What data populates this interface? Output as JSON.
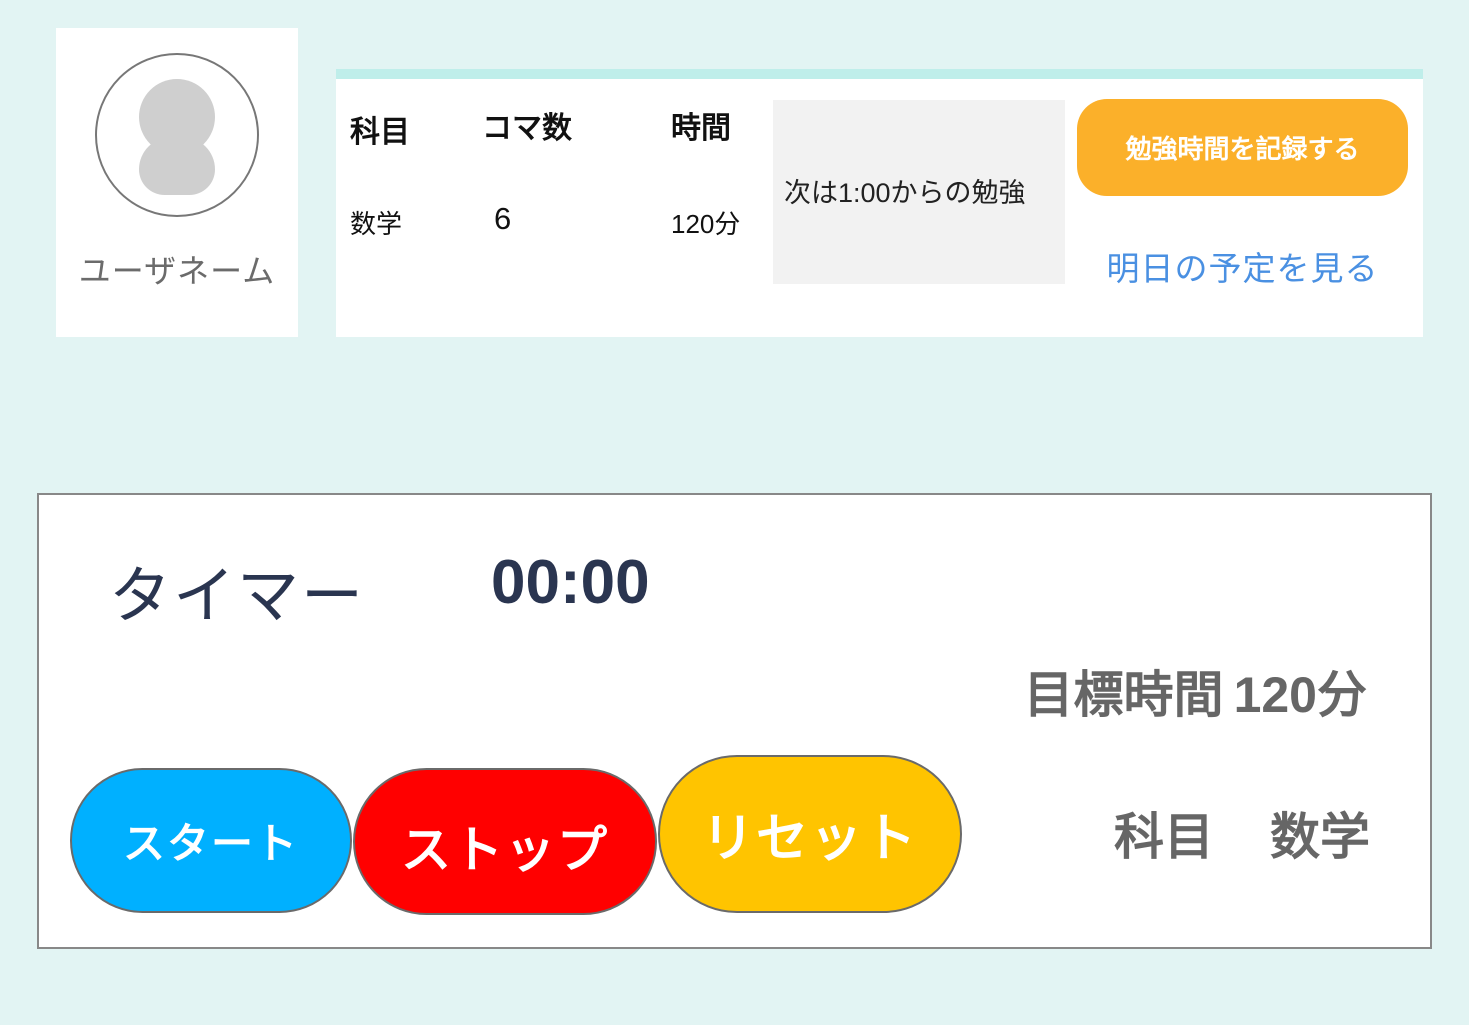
{
  "profile": {
    "username": "ユーザネーム",
    "avatar_icon": "user-silhouette-icon"
  },
  "schedule": {
    "headers": {
      "subject": "科目",
      "koma": "コマ数",
      "time": "時間"
    },
    "row": {
      "subject": "数学",
      "koma": "6",
      "time": "120分"
    },
    "next_study": "次は1:00からの勉強",
    "record_button": "勉強時間を記録する",
    "tomorrow_link": "明日の予定を見る"
  },
  "timer": {
    "label": "タイマー",
    "value": "00:00",
    "goal_label": "目標時間",
    "goal_value": "120分",
    "subject_label": "科目",
    "subject_value": "数学",
    "buttons": {
      "start": "スタート",
      "stop": "ストップ",
      "reset": "リセット"
    }
  },
  "colors": {
    "background": "#e2f4f3",
    "accent_bar": "#bfeeea",
    "record_button": "#fbb02a",
    "link": "#4a90e2",
    "start": "#00b0ff",
    "stop": "#ff0000",
    "reset": "#ffc400"
  }
}
